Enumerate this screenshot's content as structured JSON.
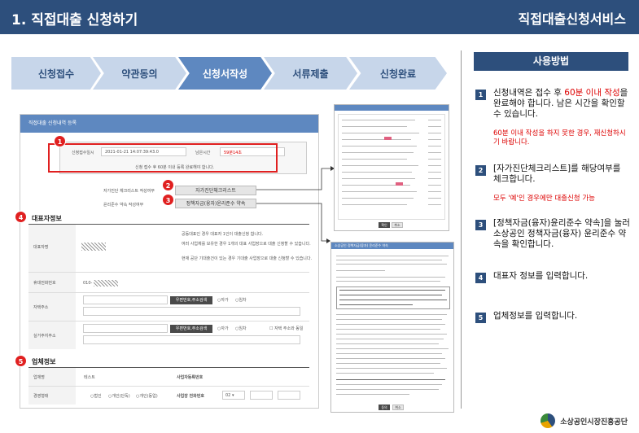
{
  "header": {
    "title": "1. 직접대출 신청하기",
    "service": "직접대출신청서비스"
  },
  "steps": [
    {
      "label": "신청접수",
      "active": false
    },
    {
      "label": "약관동의",
      "active": false
    },
    {
      "label": "신청서작성",
      "active": true
    },
    {
      "label": "서류제출",
      "active": false
    },
    {
      "label": "신청완료",
      "active": false
    }
  ],
  "howto": {
    "title": "사용방법",
    "items": [
      {
        "num": "1",
        "pre": "신청내역은 접수 후 ",
        "red": "60분 이내 작성",
        "post": "을 완료해야 합니다. 남은 시간을 확인할 수 있습니다.",
        "note": "60분 이내 작성을 하지 못한 경우, 재신청하시기 바랍니다."
      },
      {
        "num": "2",
        "text": "[자가진단체크리스트]를 해당여부를 체크합니다.",
        "note": "모두 '예'인 경우에만 대출신청 가능"
      },
      {
        "num": "3",
        "text": "[정책자금(융자)윤리준수 약속]을 눌러 소상공인 정책자금(융자) 윤리준수 약속을 확인합니다."
      },
      {
        "num": "4",
        "text": "대표자 정보를 입력합니다."
      },
      {
        "num": "5",
        "text": "업체정보를 입력합니다."
      }
    ]
  },
  "form": {
    "header": "직접대출 신청내역 등록",
    "apply_date_label": "신청접수일시",
    "apply_date_value": "2021-01-21 14:07:39:43.0",
    "remain_label": "남은시간",
    "remain_value": "59분14초",
    "remain_note": "신청 접수 후 60분 이내 등록 완료해야 합니다.",
    "checklist_label": "자가진단 체크리스트 작성여부",
    "checklist_button": "자가진단체크리스트",
    "ethics_label": "윤리준수 약속 작성여부",
    "ethics_button": "정책자금(융자)윤리준수 약속",
    "rep_section": "대표자정보",
    "rep_name_label": "대표자명",
    "rep_notes": [
      "공동대표인 경우 대표자 1인이 대출신청 합니다.",
      "여러 사업체를 보유한 경우 1개의 대표 사업장으로 대출 신청할 수 있습니다.",
      "현재 공단 기대출건이 있는 경우 기대출 사업장으로 대출 신청할 수 있습니다."
    ],
    "mobile_label": "휴대전화번호",
    "mobile_value": "010-",
    "home_label": "자택주소",
    "addr_search": "우편번호,주소검색",
    "own": "자가",
    "rent": "임차",
    "real_label": "실거주지주소",
    "same_as_home": "자택 주소와 동일",
    "biz_section": "업체정보",
    "biz_name_label": "업체명",
    "biz_name_value": "테스트",
    "bizno_label": "사업자등록번호",
    "biz_type_label": "경영형태",
    "biz_types": [
      "법인",
      "개인(단독)",
      "개인(동업)"
    ],
    "biz_tel_label": "사업장 전화번호",
    "biz_tel_area": "02"
  },
  "checklist_popup": {
    "confirm": "확인",
    "cancel": "취소"
  },
  "ethics_popup": {
    "title": "소상공인 정책자금(융자) 윤리준수 약속",
    "confirm": "동의",
    "cancel": "취소"
  },
  "footer": {
    "org": "소상공인시장진흥공단"
  }
}
